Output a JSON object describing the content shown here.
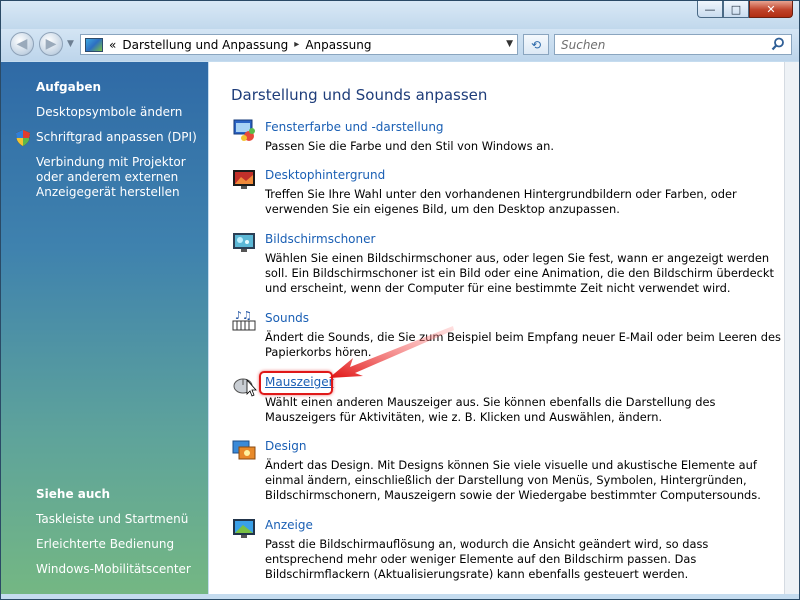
{
  "window": {
    "caption_buttons": {
      "minimize": "—",
      "maximize": "□",
      "close": "✕"
    }
  },
  "address": {
    "chevron": "«",
    "crumbs": [
      "Darstellung und Anpassung",
      "Anpassung"
    ],
    "separator": "▸",
    "search_placeholder": "Suchen"
  },
  "sidebar": {
    "tasks_heading": "Aufgaben",
    "tasks": [
      {
        "label": "Desktopsymbole ändern"
      },
      {
        "label": "Schriftgrad anpassen (DPI)",
        "icon": "shield-icon"
      },
      {
        "label": "Verbindung mit Projektor oder anderem externen Anzeigegerät herstellen"
      }
    ],
    "see_also_heading": "Siehe auch",
    "see_also": [
      {
        "label": "Taskleiste und Startmenü"
      },
      {
        "label": "Erleichterte Bedienung"
      },
      {
        "label": "Windows-Mobilitätscenter"
      }
    ]
  },
  "main": {
    "title": "Darstellung und Sounds anpassen",
    "items": [
      {
        "icon": "window-color-icon",
        "title": "Fensterfarbe und -darstellung",
        "description": "Passen Sie die Farbe und den Stil von Windows an."
      },
      {
        "icon": "desktop-background-icon",
        "title": "Desktophintergrund",
        "description": "Treffen Sie Ihre Wahl unter den vorhandenen Hintergrundbildern oder Farben, oder verwenden Sie ein eigenes Bild, um den Desktop anzupassen."
      },
      {
        "icon": "screensaver-icon",
        "title": "Bildschirmschoner",
        "description": "Wählen Sie einen Bildschirmschoner aus, oder legen Sie fest, wann er angezeigt werden soll. Ein Bildschirmschoner ist ein Bild oder eine Animation, die den Bildschirm überdeckt und erscheint, wenn der Computer für eine bestimmte Zeit nicht verwendet wird."
      },
      {
        "icon": "sounds-icon",
        "title": "Sounds",
        "description": "Ändert die Sounds, die Sie zum Beispiel beim Empfang neuer E-Mail oder beim Leeren des Papierkorbs hören."
      },
      {
        "icon": "mouse-pointer-icon",
        "title": "Mauszeiger",
        "description": "Wählt einen anderen Mauszeiger aus. Sie können ebenfalls die Darstellung des Mauszeigers für Aktivitäten, wie z. B. Klicken und Auswählen, ändern."
      },
      {
        "icon": "theme-icon",
        "title": "Design",
        "description": "Ändert das Design. Mit Designs können Sie viele visuelle und akustische Elemente auf einmal ändern, einschließlich der Darstellung von Menüs, Symbolen, Hintergründen, Bildschirmschonern, Mauszeigern sowie der Wiedergabe bestimmter Computersounds."
      },
      {
        "icon": "display-settings-icon",
        "title": "Anzeige",
        "description": "Passt die Bildschirmauflösung an, wodurch die Ansicht geändert wird, so dass entsprechend mehr oder weniger Elemente auf den Bildschirm passen. Das Bildschirmflackern (Aktualisierungsrate) kann ebenfalls gesteuert werden."
      }
    ]
  },
  "colors": {
    "link": "#1a5fb4",
    "title": "#1e3d7a",
    "highlight": "#e01818"
  }
}
